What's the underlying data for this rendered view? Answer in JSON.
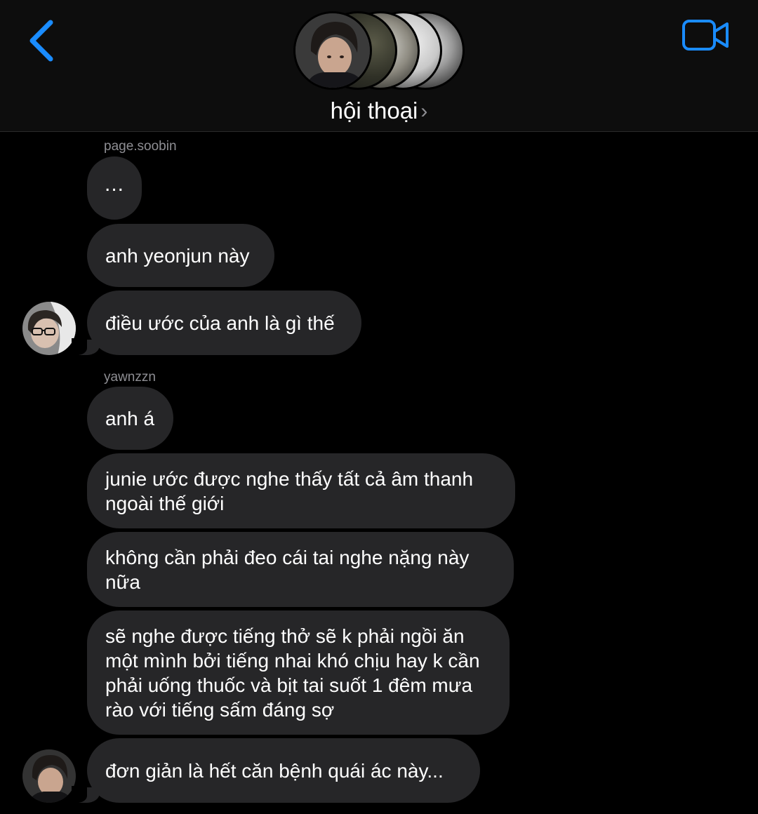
{
  "header": {
    "title": "hội thoại",
    "chevron": "›",
    "back_icon": "chevron-left-icon",
    "video_icon": "video-camera-icon",
    "accent_color": "#1a8cff"
  },
  "messages": [
    {
      "sender": "page.soobin",
      "text": "..."
    },
    {
      "text": "anh yeonjun này"
    },
    {
      "text": "điều ước của anh là gì thế"
    },
    {
      "sender": "yawnzzn",
      "text": "anh á"
    },
    {
      "text": "junie ước được nghe thấy tất cả âm thanh ngoài thế giới"
    },
    {
      "text": "không cần phải đeo cái tai nghe nặng này nữa"
    },
    {
      "text": "sẽ nghe được tiếng thở sẽ k phải ngồi ăn một mình bởi tiếng nhai khó chịu hay k cần phải uống thuốc và bịt tai suốt 1 đêm mưa rào với tiếng sấm đáng sợ"
    },
    {
      "text": "đơn giản là hết căn bệnh quái ác này..."
    }
  ],
  "colors": {
    "bubble": "#262628",
    "background": "#000000",
    "header_bg": "#0d0d0d",
    "sender_label": "#8e8e93"
  }
}
